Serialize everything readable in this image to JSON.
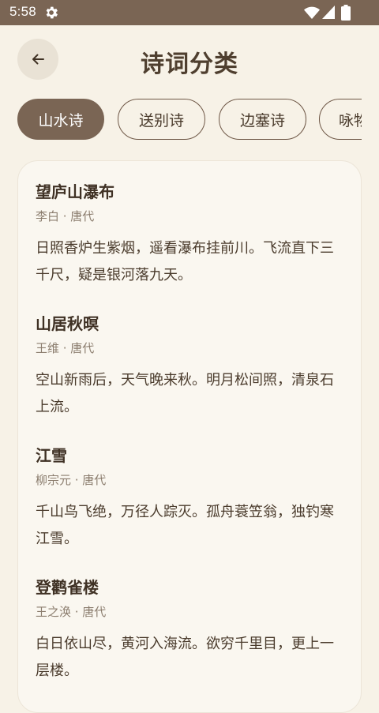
{
  "status": {
    "time": "5:58"
  },
  "header": {
    "title": "诗词分类"
  },
  "categories": [
    {
      "label": "山水诗",
      "active": true
    },
    {
      "label": "送别诗",
      "active": false
    },
    {
      "label": "边塞诗",
      "active": false
    },
    {
      "label": "咏物诗",
      "active": false
    }
  ],
  "poems": [
    {
      "title": "望庐山瀑布",
      "meta": "李白 · 唐代",
      "text": "日照香炉生紫烟，遥看瀑布挂前川。飞流直下三千尺，疑是银河落九天。"
    },
    {
      "title": "山居秋暝",
      "meta": "王维 · 唐代",
      "text": "空山新雨后，天气晚来秋。明月松间照，清泉石上流。"
    },
    {
      "title": "江雪",
      "meta": "柳宗元 · 唐代",
      "text": "千山鸟飞绝，万径人踪灭。孤舟蓑笠翁，独钓寒江雪。"
    },
    {
      "title": "登鹳雀楼",
      "meta": "王之涣 · 唐代",
      "text": "白日依山尽，黄河入海流。欲穷千里目，更上一层楼。"
    }
  ],
  "colors": {
    "accent": "#7a6554",
    "background": "#f7f2e7",
    "card": "#faf7f0"
  }
}
